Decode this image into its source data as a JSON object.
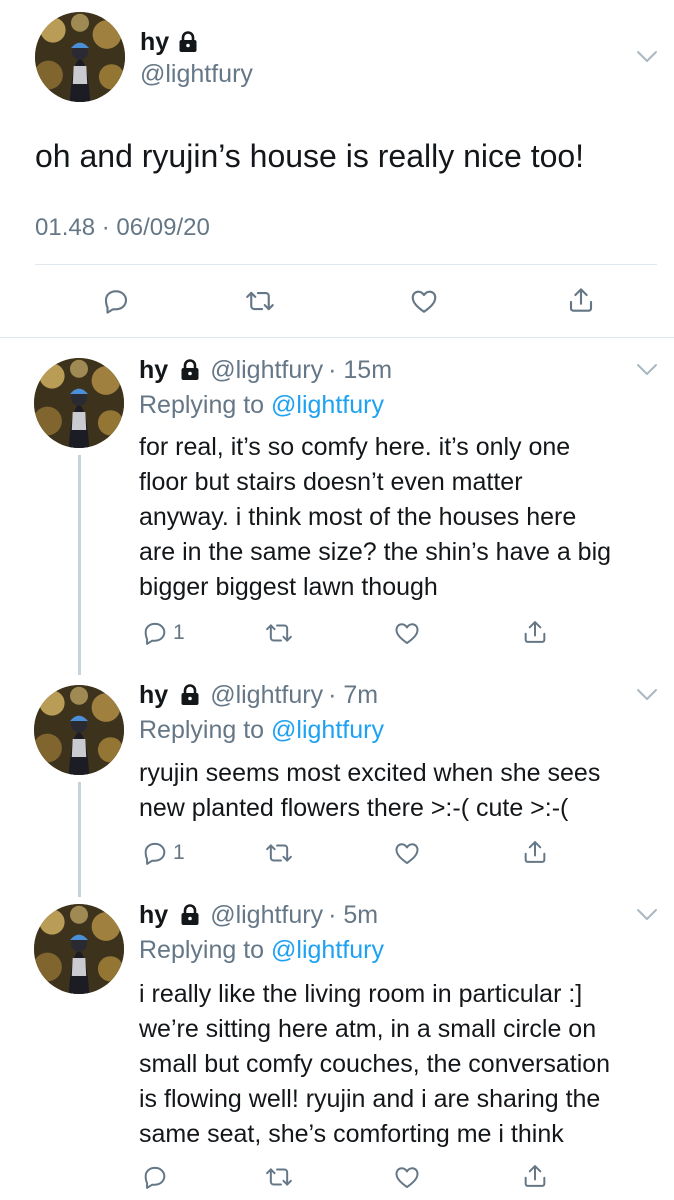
{
  "main_tweet": {
    "display_name": "hy",
    "handle": "@lightfury",
    "text": "oh and ryujin’s house is really nice too!",
    "timestamp": "01.48 · 06/09/20"
  },
  "replies": [
    {
      "display_name": "hy",
      "handle": "@lightfury",
      "time": "· 15m",
      "replying_prefix": "Replying to",
      "replying_handle": "@lightfury",
      "lines": [
        "for real, it’s so comfy here. it’s only one",
        "floor but stairs doesn’t even matter",
        "anyway. i think most of the houses here",
        "are in the same size? the shin’s have a big",
        "bigger biggest lawn though"
      ],
      "reply_count": "1"
    },
    {
      "display_name": "hy",
      "handle": "@lightfury",
      "time": "· 7m",
      "replying_prefix": "Replying to",
      "replying_handle": "@lightfury",
      "lines": [
        "ryujin seems most excited when she sees",
        "new planted flowers there >:-( cute >:-("
      ],
      "reply_count": "1"
    },
    {
      "display_name": "hy",
      "handle": "@lightfury",
      "time": "· 5m",
      "replying_prefix": "Replying to",
      "replying_handle": "@lightfury",
      "lines": [
        "i really like the living room in particular :]",
        "we’re sitting here atm, in a small circle on",
        "small but comfy couches, the conversation",
        "is flowing well! ryujin and i are sharing the",
        "same seat, she’s comforting me i think"
      ],
      "reply_count": ""
    }
  ],
  "icons": {
    "reply": "speech-bubble-icon",
    "retweet": "retweet-icon",
    "like": "heart-icon",
    "share": "share-icon",
    "lock": "lock-icon",
    "caret": "chevron-down-icon"
  },
  "colors": {
    "text": "#14171a",
    "secondary": "#657786",
    "link": "#1da1f2",
    "thread_line": "#c7d3dc"
  }
}
